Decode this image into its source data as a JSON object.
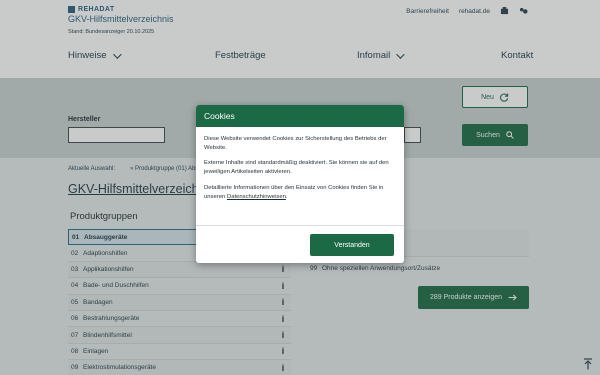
{
  "header": {
    "brand": "REHADAT",
    "subtitle": "GKV-Hilfsmittelverzeichnis",
    "date": "Stand: Bundesanzeiger 20.10.2025",
    "util": [
      "Barrierefreiheit",
      "rehadat.de"
    ],
    "nav": [
      {
        "label": "Hinweise",
        "dropdown": true
      },
      {
        "label": "Festbeträge",
        "dropdown": false
      },
      {
        "label": "Infomail",
        "dropdown": true
      },
      {
        "label": "Kontakt",
        "dropdown": false
      }
    ]
  },
  "filter": {
    "manufacturer_label": "Hersteller",
    "new_button": "Neu",
    "search_button": "Suchen"
  },
  "breadcrumb": {
    "first": "Aktuelle Auswahl:",
    "second": "» Produktgruppe (01) Absau"
  },
  "page_title": "GKV-Hilfsmittelverzeich",
  "product_groups": {
    "title": "Produktgruppen",
    "items": [
      {
        "num": "01",
        "label": "Absauggeräte",
        "active": true
      },
      {
        "num": "02",
        "label": "Adaptionshilfen",
        "active": false
      },
      {
        "num": "03",
        "label": "Applikationshilfen",
        "active": false
      },
      {
        "num": "04",
        "label": "Bade- und Duschhilfen",
        "active": false
      },
      {
        "num": "05",
        "label": "Bandagen",
        "active": false
      },
      {
        "num": "06",
        "label": "Bestrahlungsgeräte",
        "active": false
      },
      {
        "num": "07",
        "label": "Blindenhilfsmittel",
        "active": false
      },
      {
        "num": "08",
        "label": "Einlagen",
        "active": false
      },
      {
        "num": "09",
        "label": "Elektrostimulationsgeräte",
        "active": false
      }
    ],
    "info_glyph": "i"
  },
  "sub_groups": {
    "row": {
      "num": "99",
      "label": "Ohne speziellen Anwendungsort/Zusätze"
    },
    "products_button": "289 Produkte anzeigen"
  },
  "cookie_modal": {
    "title": "Cookies",
    "p1": "Diese Website verwendet Cookies zur Sicherstellung des Betriebs der Website.",
    "p2": "Externe Inhalte sind standardmäßig deaktiviert. Sie können sie auf den jeweiligen Artikelseiten aktivieren.",
    "p3_before": "Detaillierte Informationen über den Einsatz von Cookies finden Sie in unseren ",
    "p3_link": "Datenschutzhinweisen",
    "p3_after": ".",
    "accept": "Verstanden"
  },
  "colors": {
    "brand_green": "#1c6a45",
    "brand_blue": "#2b5f7c"
  }
}
